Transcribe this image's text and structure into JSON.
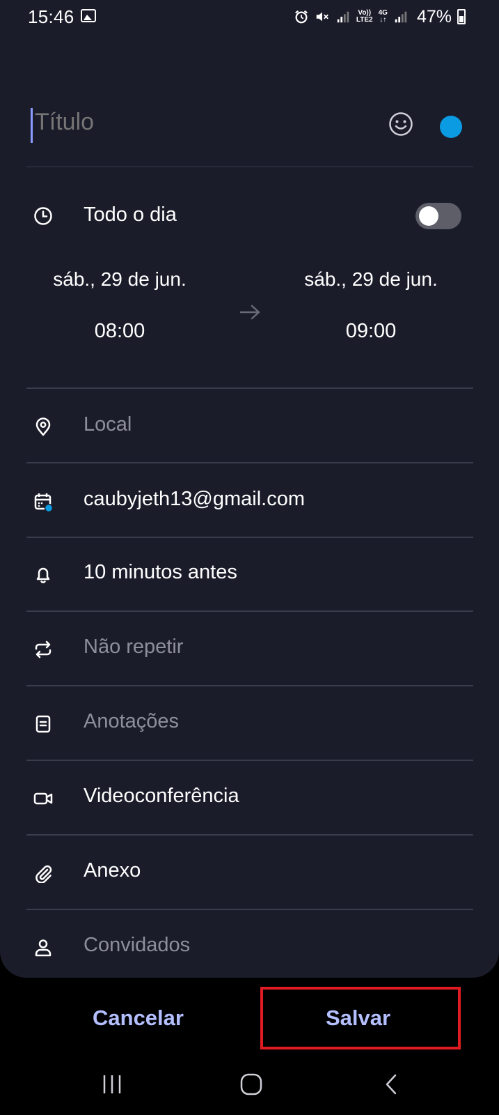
{
  "status_bar": {
    "time": "15:46",
    "network_top": "Vo))",
    "network_bottom": "LTE2",
    "network_gen": "4G",
    "battery": "47%"
  },
  "title": {
    "placeholder": "Título",
    "value": ""
  },
  "colors": {
    "background": "#1b1c2a",
    "accent": "#b4bfff",
    "event_color": "#0b9be3",
    "highlight": "#e11b22"
  },
  "all_day": {
    "label": "Todo o dia",
    "enabled": false
  },
  "start": {
    "date": "sáb., 29 de jun.",
    "time": "08:00"
  },
  "end": {
    "date": "sáb., 29 de jun.",
    "time": "09:00"
  },
  "fields": [
    {
      "icon": "location-pin-icon",
      "label": "Local",
      "placeholder": true
    },
    {
      "icon": "calendar-account-icon",
      "label": "caubyjeth13@gmail.com",
      "placeholder": false
    },
    {
      "icon": "bell-icon",
      "label": "10 minutos antes",
      "placeholder": false
    },
    {
      "icon": "repeat-icon",
      "label": "Não repetir",
      "placeholder": true
    },
    {
      "icon": "note-icon",
      "label": "Anotações",
      "placeholder": true
    },
    {
      "icon": "video-icon",
      "label": "Videoconferência",
      "placeholder": false
    },
    {
      "icon": "paperclip-icon",
      "label": "Anexo",
      "placeholder": false
    },
    {
      "icon": "person-icon",
      "label": "Convidados",
      "placeholder": true
    }
  ],
  "actions": {
    "cancel": "Cancelar",
    "save": "Salvar"
  },
  "nav": {
    "recents": "recents-icon",
    "home": "home-icon",
    "back": "back-icon"
  }
}
